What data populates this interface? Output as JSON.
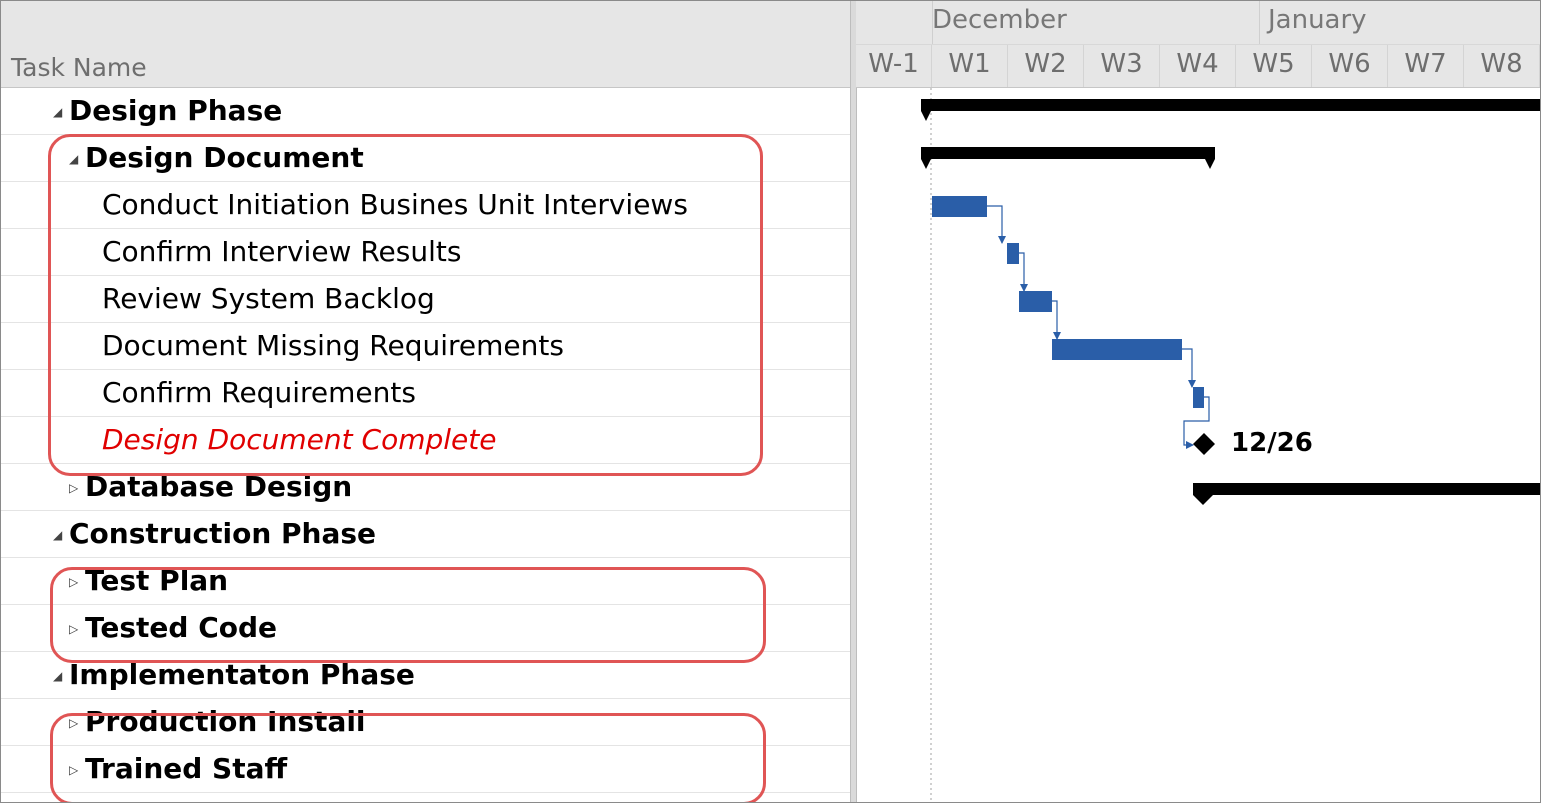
{
  "grid": {
    "column_title": "Task Name",
    "rows": [
      {
        "id": "design-phase",
        "label": "Design Phase",
        "indent": 0,
        "bold": true,
        "toggle": "open"
      },
      {
        "id": "design-document",
        "label": "Design Document",
        "indent": 1,
        "bold": true,
        "toggle": "open"
      },
      {
        "id": "conduct-interviews",
        "label": "Conduct Initiation Busines Unit Interviews",
        "indent": 2,
        "bold": false,
        "toggle": "none"
      },
      {
        "id": "confirm-interview-results",
        "label": "Confirm Interview Results",
        "indent": 2,
        "bold": false,
        "toggle": "none"
      },
      {
        "id": "review-system-backlog",
        "label": "Review System Backlog",
        "indent": 2,
        "bold": false,
        "toggle": "none"
      },
      {
        "id": "document-missing-requirements",
        "label": "Document Missing Requirements",
        "indent": 2,
        "bold": false,
        "toggle": "none"
      },
      {
        "id": "confirm-requirements",
        "label": "Confirm Requirements",
        "indent": 2,
        "bold": false,
        "toggle": "none"
      },
      {
        "id": "design-document-complete",
        "label": "Design Document Complete",
        "indent": 2,
        "bold": false,
        "toggle": "none",
        "milestone": true
      },
      {
        "id": "database-design",
        "label": "Database Design",
        "indent": 1,
        "bold": true,
        "toggle": "closed"
      },
      {
        "id": "construction-phase",
        "label": "Construction Phase",
        "indent": 0,
        "bold": true,
        "toggle": "open"
      },
      {
        "id": "test-plan",
        "label": "Test Plan",
        "indent": 1,
        "bold": true,
        "toggle": "closed"
      },
      {
        "id": "tested-code",
        "label": "Tested Code",
        "indent": 1,
        "bold": true,
        "toggle": "closed"
      },
      {
        "id": "implementation-phase",
        "label": "Implementaton Phase",
        "indent": 0,
        "bold": true,
        "toggle": "open"
      },
      {
        "id": "production-install",
        "label": "Production Install",
        "indent": 1,
        "bold": true,
        "toggle": "closed"
      },
      {
        "id": "trained-staff",
        "label": "Trained Staff",
        "indent": 1,
        "bold": true,
        "toggle": "closed"
      }
    ]
  },
  "timescale": {
    "months": [
      "December",
      "January"
    ],
    "weeks": [
      "W-1",
      "W1",
      "W2",
      "W3",
      "W4",
      "W5",
      "W6",
      "W7",
      "W8"
    ]
  },
  "gantt": {
    "milestone_label": "12/26",
    "colors": {
      "task_bar": "#2a5ea8",
      "summary_bar": "#000000",
      "milestone_text": "#e00000",
      "highlight": "#e05555"
    }
  }
}
